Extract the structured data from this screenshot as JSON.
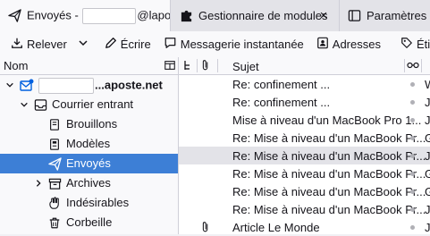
{
  "tabs": [
    {
      "label_prefix": "Envoyés - ",
      "label_suffix": "@lapo",
      "icon": "paper-plane-icon",
      "close": "×"
    },
    {
      "label": "Gestionnaire de modules",
      "icon": "puzzle-icon",
      "close": "×"
    },
    {
      "label": "Paramètres d",
      "icon": "settings-tab-icon"
    }
  ],
  "toolbar": {
    "reply_label": "Relever",
    "compose_label": "Écrire",
    "chat_label": "Messagerie instantanée",
    "address_label": "Adresses",
    "tag_label": "Étiqu"
  },
  "folder_pane": {
    "header": "Nom",
    "account_suffix": "...aposte.net",
    "folders": [
      {
        "label": "Courrier entrant",
        "icon": "inbox-icon"
      },
      {
        "label": "Brouillons",
        "icon": "drafts-icon"
      },
      {
        "label": "Modèles",
        "icon": "templates-icon"
      },
      {
        "label": "Envoyés",
        "icon": "sent-icon"
      },
      {
        "label": "Archives",
        "icon": "archive-icon"
      },
      {
        "label": "Indésirables",
        "icon": "junk-icon"
      },
      {
        "label": "Corbeille",
        "icon": "trash-icon"
      }
    ]
  },
  "message_list": {
    "subject_header": "Sujet",
    "messages": [
      {
        "subject": "Re: confinement ...",
        "correspondent": "W",
        "attachment": false
      },
      {
        "subject": "Re: confinement ...",
        "correspondent": "J",
        "attachment": false
      },
      {
        "subject": "Mise à niveau d'un MacBook Pro 1...",
        "correspondent": "J",
        "attachment": false
      },
      {
        "subject": "Re: Mise à niveau d'un MacBook Pr...",
        "correspondent": "G",
        "attachment": false
      },
      {
        "subject": "Re: Mise à niveau d'un MacBook Pr...",
        "correspondent": "J",
        "attachment": false
      },
      {
        "subject": "Re: Mise à niveau d'un MacBook Pr...",
        "correspondent": "G",
        "attachment": false
      },
      {
        "subject": "Re: Mise à niveau d'un MacBook Pr...",
        "correspondent": "G",
        "attachment": false
      },
      {
        "subject": "Re: Mise à niveau d'un MacBook Pr...",
        "correspondent": "J",
        "attachment": false
      },
      {
        "subject": "Article Le Monde",
        "correspondent": "J",
        "attachment": true
      }
    ]
  },
  "colors": {
    "selection": "#3d7fd6",
    "accent": "#0060df"
  }
}
